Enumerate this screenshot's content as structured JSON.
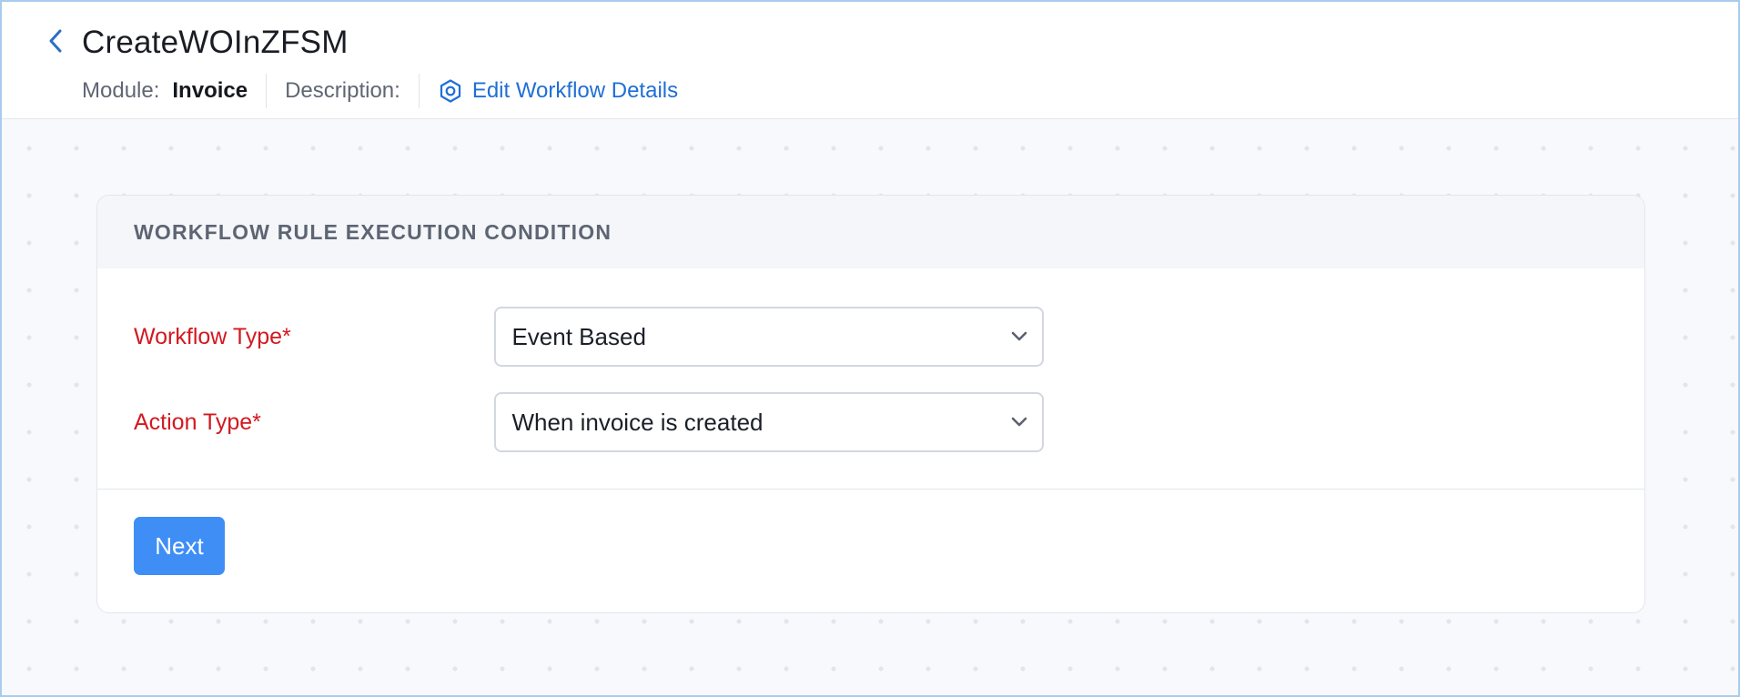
{
  "header": {
    "title": "CreateWOInZFSM",
    "back_icon": "chevron-left-icon",
    "module_label": "Module:",
    "module_value": "Invoice",
    "description_label": "Description:",
    "edit_link_label": "Edit Workflow Details",
    "edit_link_icon": "gear-icon"
  },
  "card": {
    "title": "WORKFLOW RULE EXECUTION CONDITION",
    "fields": [
      {
        "label": "Workflow Type*",
        "value": "Event Based",
        "icon": "chevron-down-icon"
      },
      {
        "label": "Action Type*",
        "value": "When invoice is created",
        "icon": "chevron-down-icon"
      }
    ],
    "next_label": "Next"
  },
  "colors": {
    "accent": "#3e8ef6",
    "link": "#1f6fd6",
    "required_label": "#d2191f",
    "frame_border": "#a9ccee",
    "canvas_bg": "#f8f9fc"
  }
}
